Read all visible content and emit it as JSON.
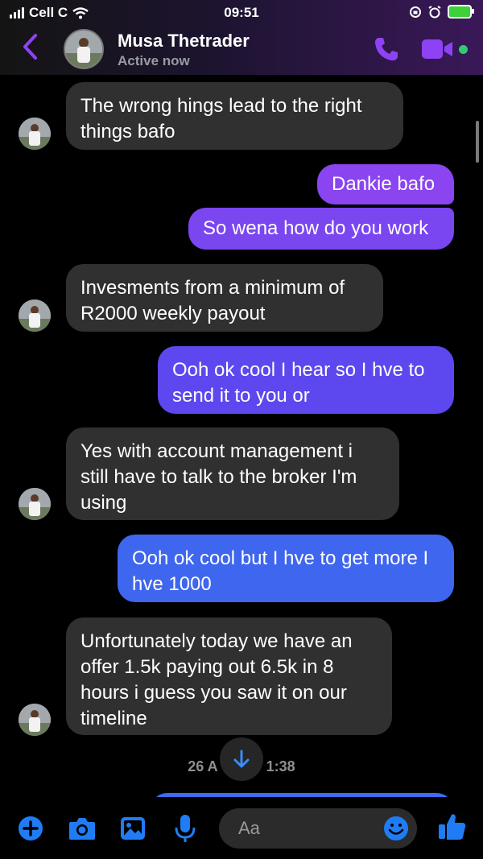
{
  "status_bar": {
    "carrier": "Cell C",
    "time": "09:51"
  },
  "header": {
    "contact_name": "Musa Thetrader",
    "presence": "Active now"
  },
  "messages": [
    {
      "dir": "in",
      "text": "The wrong hings lead to the right things bafo"
    },
    {
      "dir": "out",
      "text": "Dankie bafo"
    },
    {
      "dir": "out",
      "text": "So wena how do you work"
    },
    {
      "dir": "in",
      "text": "Invesments from a minimum of R2000 weekly payout"
    },
    {
      "dir": "out",
      "text": "Ooh ok cool I hear so I hve to send it to you or"
    },
    {
      "dir": "in",
      "text": "Yes with account management  i still have to talk to the broker I'm using"
    },
    {
      "dir": "out",
      "text": "Ooh ok cool but I hve to get more I hve 1000"
    },
    {
      "dir": "in",
      "text": "Unfortunately today we have an offer 1.5k paying out 6.5k in 8 hours i guess you saw it on our timeline"
    }
  ],
  "timestamp": {
    "left": "26 A",
    "right": "1:38"
  },
  "composer": {
    "placeholder": "Aa"
  },
  "colors": {
    "incoming": "#303030",
    "outgoing_purple": "#8a44f0",
    "outgoing_violet": "#5c48ee",
    "outgoing_blue": "#3f66ee",
    "accent": "#8d43f5",
    "composer_blue": "#1f7cf4"
  },
  "icons": {
    "header": [
      "back-chevron-icon",
      "phone-icon",
      "video-camera-icon",
      "online-dot"
    ],
    "composer": [
      "add-icon",
      "camera-icon",
      "image-icon",
      "microphone-icon",
      "emoji-icon",
      "thumbs-up-icon"
    ],
    "status": [
      "signal-icon",
      "wifi-icon",
      "lock-rotation-icon",
      "alarm-icon",
      "battery-icon"
    ]
  }
}
